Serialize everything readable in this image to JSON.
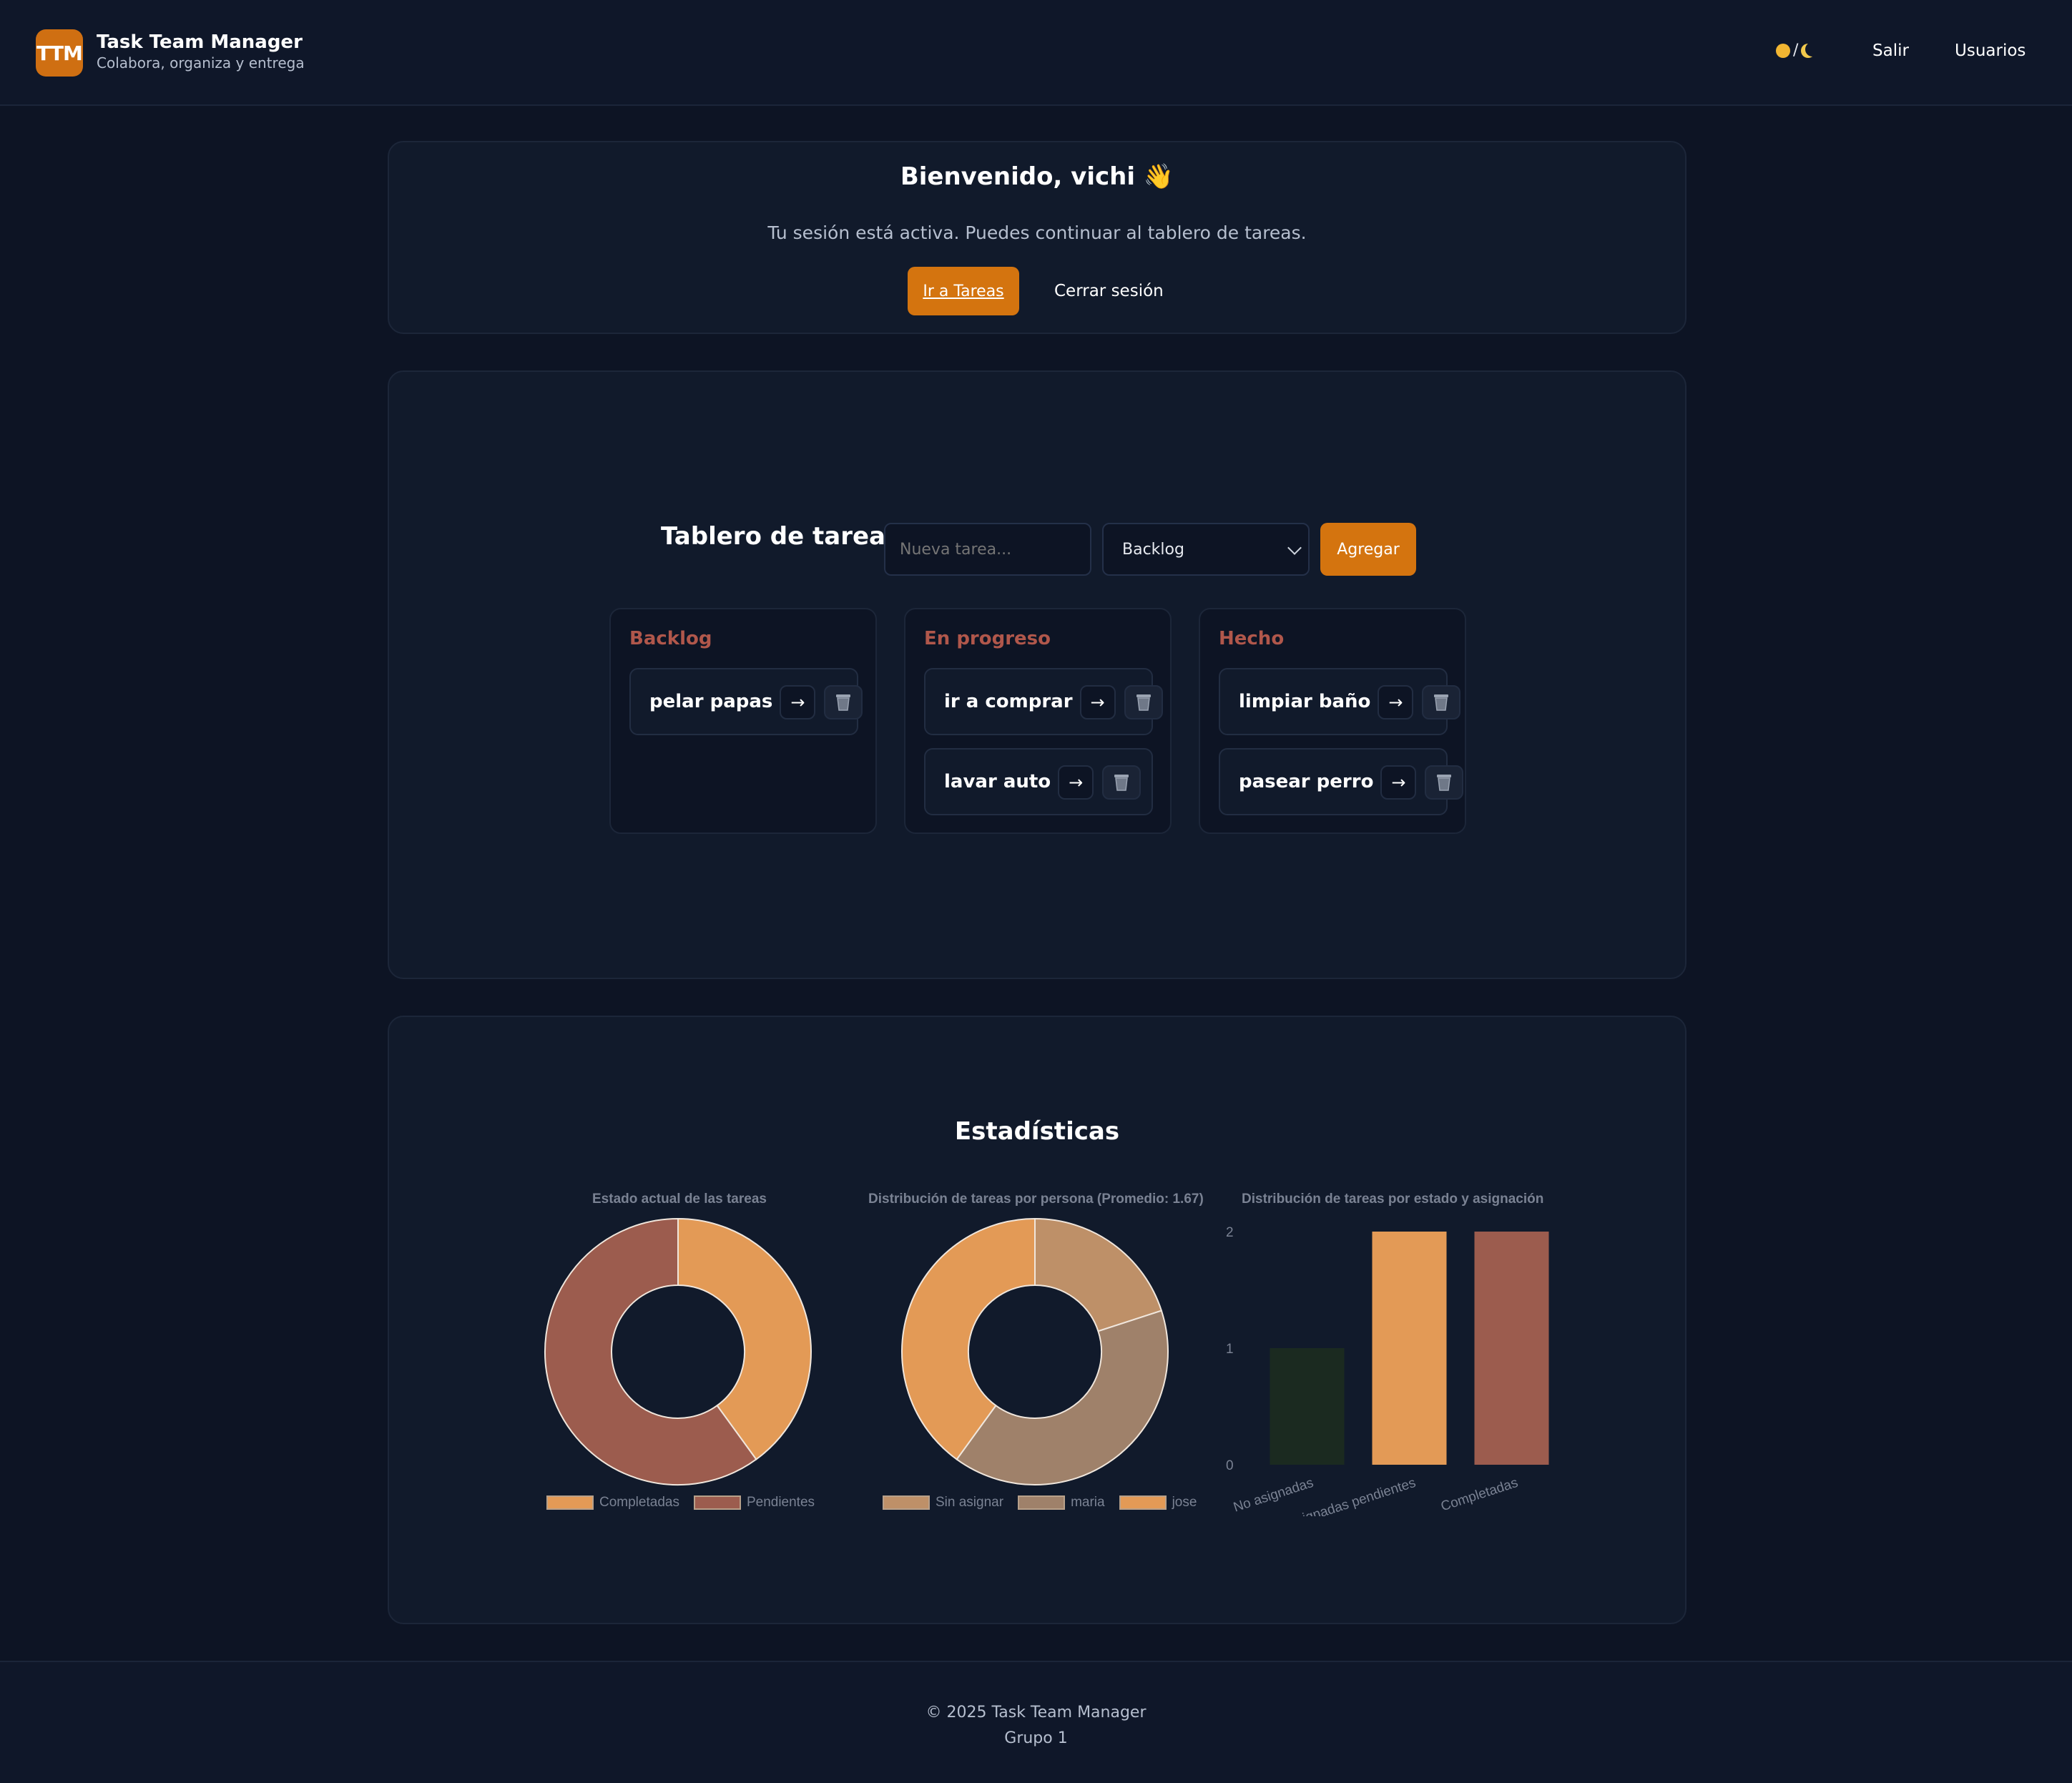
{
  "header": {
    "logo_text": "TTM",
    "title": "Task Team Manager",
    "subtitle": "Colabora, organiza y entrega",
    "theme_toggle_sep": "/",
    "nav": [
      {
        "label": "Salir"
      },
      {
        "label": "Usuarios"
      }
    ]
  },
  "welcome": {
    "title": "Bienvenido, vichi 👋",
    "text": "Tu sesión está activa. Puedes continuar al tablero de tareas.",
    "primary_label": "Ir a Tareas",
    "logout_label": "Cerrar sesión"
  },
  "board": {
    "title": "Tablero de tareas",
    "input_placeholder": "Nueva tarea...",
    "select_value": "Backlog",
    "add_label": "Agregar",
    "move_symbol": "→",
    "columns": [
      {
        "title": "Backlog",
        "tasks": [
          "pelar papas"
        ]
      },
      {
        "title": "En progreso",
        "tasks": [
          "ir a comprar",
          "lavar auto"
        ]
      },
      {
        "title": "Hecho",
        "tasks": [
          "limpiar baño",
          "pasear perro"
        ]
      }
    ]
  },
  "stats": {
    "title": "Estadísticas",
    "colors": {
      "orange": "#e39a56",
      "brown": "#9c5c4e",
      "tan": "#be9068",
      "taupe": "#9f816a",
      "darkgreen": "#1b2a20",
      "border": "#f0e6dc"
    }
  },
  "chart_data": [
    {
      "type": "pie",
      "title": "Estado actual de las tareas",
      "labels": [
        "Completadas",
        "Pendientes"
      ],
      "values": [
        2,
        3
      ],
      "colors": [
        "#e39a56",
        "#9c5c4e"
      ],
      "legend": "bottom"
    },
    {
      "type": "pie",
      "title": "Distribución de tareas por persona (Promedio: 1.67)",
      "labels": [
        "Sin asignar",
        "maria",
        "jose"
      ],
      "values": [
        1,
        2,
        2
      ],
      "colors": [
        "#be9068",
        "#9f816a",
        "#e39a56"
      ],
      "legend": "bottom"
    },
    {
      "type": "bar",
      "title": "Distribución de tareas por estado y asignación",
      "categories": [
        "No asignadas",
        "Asignadas pendientes",
        "Completadas"
      ],
      "values": [
        1,
        2,
        2
      ],
      "colors": [
        "#1b2a20",
        "#e39a56",
        "#9c5c4e"
      ],
      "ylim": [
        0,
        2
      ],
      "yticks": [
        "0",
        "1",
        "2"
      ],
      "legend": "none"
    }
  ],
  "footer": {
    "line1": "© 2025 Task Team Manager",
    "line2": "Grupo 1"
  }
}
